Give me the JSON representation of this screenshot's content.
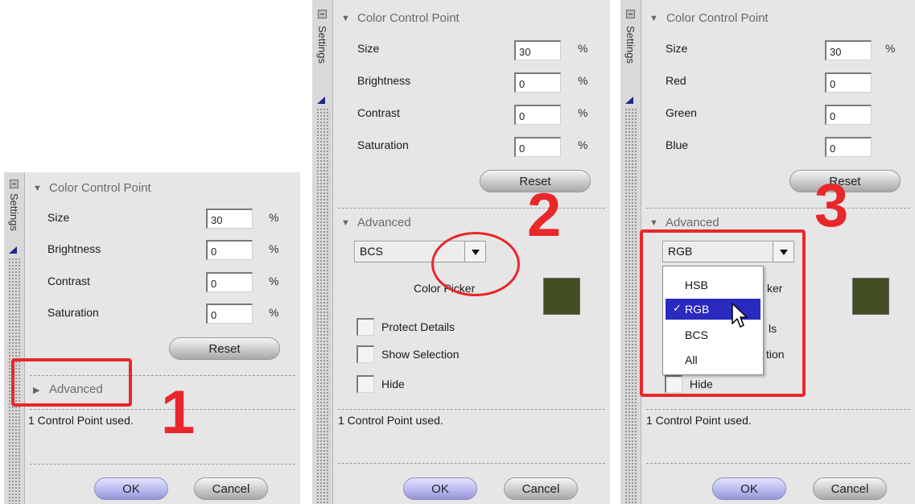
{
  "panels": [
    {
      "section_title": "Color Control Point",
      "strip_label": "Settings",
      "rows": [
        {
          "label": "Size",
          "value": "30",
          "unit": "%"
        },
        {
          "label": "Brightness",
          "value": "0",
          "unit": "%"
        },
        {
          "label": "Contrast",
          "value": "0",
          "unit": "%"
        },
        {
          "label": "Saturation",
          "value": "0",
          "unit": "%"
        }
      ],
      "reset_label": "Reset",
      "advanced_label": "Advanced",
      "status": "1 Control Point used.",
      "ok_label": "OK",
      "cancel_label": "Cancel",
      "annotation": "1"
    },
    {
      "section_title": "Color Control Point",
      "strip_label": "Settings",
      "rows": [
        {
          "label": "Size",
          "value": "30",
          "unit": "%"
        },
        {
          "label": "Brightness",
          "value": "0",
          "unit": "%"
        },
        {
          "label": "Contrast",
          "value": "0",
          "unit": "%"
        },
        {
          "label": "Saturation",
          "value": "0",
          "unit": "%"
        }
      ],
      "reset_label": "Reset",
      "advanced_label": "Advanced",
      "mode_value": "BCS",
      "color_picker_label": "Color Picker",
      "checkboxes": [
        "Protect Details",
        "Show Selection",
        "Hide"
      ],
      "status": "1 Control Point used.",
      "ok_label": "OK",
      "cancel_label": "Cancel",
      "annotation": "2"
    },
    {
      "section_title": "Color Control Point",
      "strip_label": "Settings",
      "rows": [
        {
          "label": "Size",
          "value": "30",
          "unit": "%"
        },
        {
          "label": "Red",
          "value": "0",
          "unit": ""
        },
        {
          "label": "Green",
          "value": "0",
          "unit": ""
        },
        {
          "label": "Blue",
          "value": "0",
          "unit": ""
        }
      ],
      "reset_label": "Reset",
      "advanced_label": "Advanced",
      "mode_value": "RGB",
      "dropdown_options": [
        "HSB",
        "RGB",
        "BCS",
        "All"
      ],
      "dropdown_selected": "RGB",
      "hidden_fragments": {
        "picker": "ker",
        "details": "ls",
        "selection": "tion"
      },
      "hide_label": "Hide",
      "status": "1 Control Point used.",
      "ok_label": "OK",
      "cancel_label": "Cancel",
      "annotation": "3"
    }
  ],
  "colors": {
    "swatch": "#434d22",
    "annotation": "#e8272b",
    "selection": "#2a2abf"
  }
}
